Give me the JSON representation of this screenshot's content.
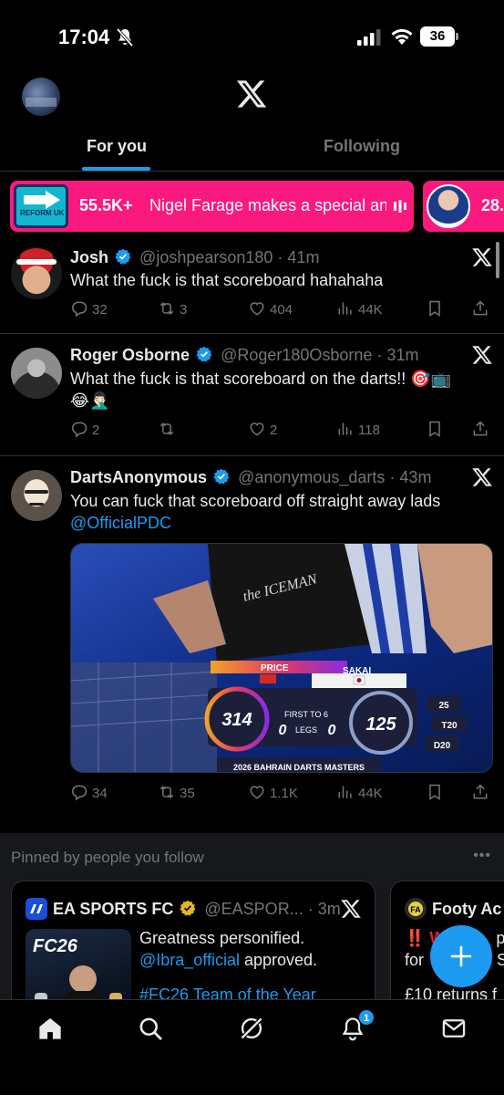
{
  "status_bar": {
    "time": "17:04",
    "battery": "36"
  },
  "header": {
    "tabs": [
      {
        "label": "For you",
        "active": true
      },
      {
        "label": "Following",
        "active": false
      }
    ]
  },
  "live_banners": [
    {
      "logo_text": "REFORM UK",
      "count": "55.5K+",
      "title": "Nigel Farage makes a special ann",
      "color": "#f9197f"
    },
    {
      "count": "28."
    }
  ],
  "posts": [
    {
      "name": "Josh",
      "handle": "@joshpearson180",
      "time": "41m",
      "text": "What the fuck is that scoreboard hahahaha",
      "replies": "32",
      "reposts": "3",
      "likes": "404",
      "views": "44K"
    },
    {
      "name": "Roger Osborne",
      "handle": "@Roger180Osborne",
      "time": "31m",
      "text": "What the fuck is that scoreboard on the darts!! 🎯📺",
      "text2": "😂🤦🏻‍♂️",
      "replies": "2",
      "reposts": "",
      "likes": "2",
      "views": "118"
    },
    {
      "name": "DartsAnonymous",
      "handle": "@anonymous_darts",
      "time": "43m",
      "text": "You can fuck that scoreboard off straight away lads",
      "mention": "@OfficialPDC",
      "replies": "34",
      "reposts": "35",
      "likes": "1.1K",
      "views": "44K",
      "media": {
        "shirt_text": "the ICEMAN",
        "player1": "PRICE",
        "player2": "SAKAI",
        "score1": "314",
        "score2": "125",
        "format": "FIRST TO 6",
        "legs1": "0",
        "legs_label": "LEGS",
        "legs2": "0",
        "checkout": [
          "25",
          "T20",
          "D20"
        ],
        "event": "2026 BAHRAIN DARTS MASTERS"
      }
    }
  ],
  "pinned": {
    "title": "Pinned by people you follow",
    "cards": [
      {
        "name": "EA SPORTS FC",
        "handle": "@EASPOR...",
        "time": "3m",
        "line1": "Greatness personified.",
        "mention": "@Ibra_official",
        "line2_rest": " approved.",
        "line3": "#FC26 Team of the Year",
        "image_text": "FC26"
      },
      {
        "name": "Footy Ac",
        "line1": "‼️ W",
        "line1b": "pic",
        "line2": "for",
        "line2b": "s S",
        "line3": "£10 returns f"
      }
    ]
  },
  "bottom_nav": {
    "notifications_count": "1"
  },
  "colors": {
    "accent": "#1d9bf0",
    "live": "#f9197f",
    "muted": "#71767b",
    "border": "#2f3336"
  }
}
